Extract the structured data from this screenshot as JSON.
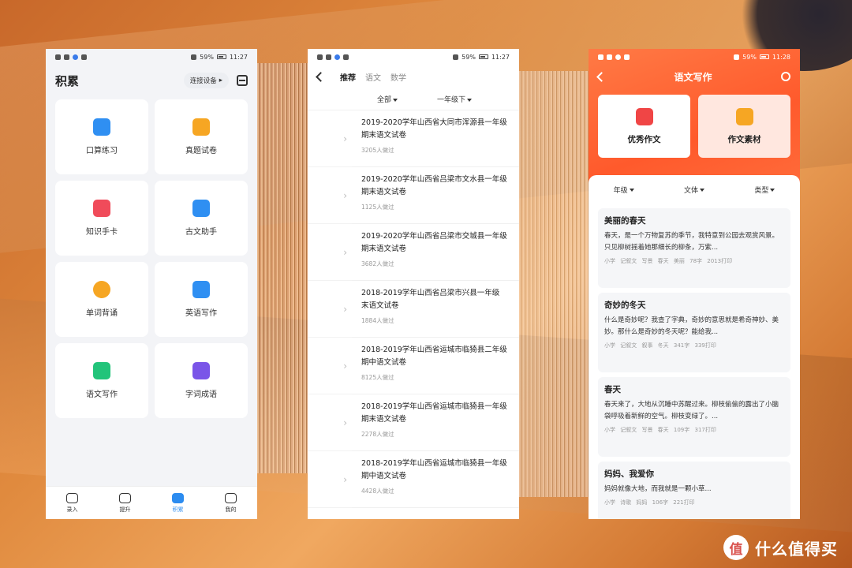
{
  "status": {
    "battery": "59%",
    "time_p1": "11:27",
    "time_p2": "11:27",
    "time_p3": "11:28"
  },
  "p1": {
    "title": "积累",
    "connect_label": "连接设备",
    "tiles": [
      {
        "label": "口算练习",
        "icon": "calculator-icon",
        "color": "#2f8ff2"
      },
      {
        "label": "真题试卷",
        "icon": "exam-paper-icon",
        "color": "#f6a623"
      },
      {
        "label": "知识手卡",
        "icon": "knowledge-card-icon",
        "color": "#f04b5a"
      },
      {
        "label": "古文助手",
        "icon": "ancient-text-icon",
        "color": "#2f8ff2"
      },
      {
        "label": "单词背诵",
        "icon": "word-recite-icon",
        "color": "#f6a623"
      },
      {
        "label": "英语写作",
        "icon": "english-writing-icon",
        "color": "#2f8ff2"
      },
      {
        "label": "语文写作",
        "icon": "chinese-writing-icon",
        "color": "#22c47a"
      },
      {
        "label": "字词成语",
        "icon": "idiom-icon",
        "color": "#7a55e8"
      }
    ],
    "tabs": [
      {
        "label": "录入",
        "icon": "camera-icon"
      },
      {
        "label": "提升",
        "icon": "upgrade-icon"
      },
      {
        "label": "积累",
        "icon": "accumulate-icon"
      },
      {
        "label": "我的",
        "icon": "profile-icon"
      }
    ]
  },
  "p2": {
    "tabs": [
      "推荐",
      "语文",
      "数学"
    ],
    "filter_all": "全部",
    "filter_grade": "一年级下",
    "exams": [
      {
        "line1": "2019-2020学年山西省大同市浑源县一年级",
        "line2": "期末语文试卷",
        "count": "3205人做过"
      },
      {
        "line1": "2019-2020学年山西省吕梁市文水县一年级",
        "line2": "期末语文试卷",
        "count": "1125人做过"
      },
      {
        "line1": "2019-2020学年山西省吕梁市交城县一年级",
        "line2": "期末语文试卷",
        "count": "3682人做过"
      },
      {
        "line1": "2018-2019学年山西省吕梁市兴县一年级",
        "line2": "末语文试卷",
        "count": "1884人做过"
      },
      {
        "line1": "2018-2019学年山西省运城市临猗县二年级",
        "line2": "期中语文试卷",
        "count": "8125人做过"
      },
      {
        "line1": "2018-2019学年山西省运城市临猗县一年级",
        "line2": "期末语文试卷",
        "count": "2278人做过"
      },
      {
        "line1": "2018-2019学年山西省运城市临猗县一年级",
        "line2": "期中语文试卷",
        "count": "4428人做过"
      }
    ]
  },
  "p3": {
    "title": "语文写作",
    "card1": "优秀作文",
    "card2": "作文素材",
    "filters": [
      "年级",
      "文体",
      "类型"
    ],
    "essays": [
      {
        "title": "美丽的春天",
        "text": "春天，是一个万物复苏的季节，我特意到公园去观赏风景。只见柳树摇着她那细长的柳条，万紫...",
        "tags": "小学 记叙文 写景 春天 美丽 78字 2013打印"
      },
      {
        "title": "奇妙的冬天",
        "text": "什么是奇妙呢？我查了字典，奇妙的意思就是希奇神妙、美妙。那什么是奇妙的冬天呢？能给我...",
        "tags": "小学 记叙文 叙事 冬天 341字 339打印"
      },
      {
        "title": "春天",
        "text": "春天来了，大地从沉睡中苏醒过来。柳枝偷偷的露出了小脑袋呼吸着新鲜的空气。柳枝变绿了。...",
        "tags": "小学 记叙文 写景 春天 109字 317打印"
      },
      {
        "title": "妈妈、我爱你",
        "text": "妈妈就像大地，而我就是一颗小草...",
        "tags": "小学 诗歌 妈妈 106字 221打印"
      }
    ]
  },
  "watermark": {
    "symbol": "值",
    "text": "什么值得买"
  }
}
